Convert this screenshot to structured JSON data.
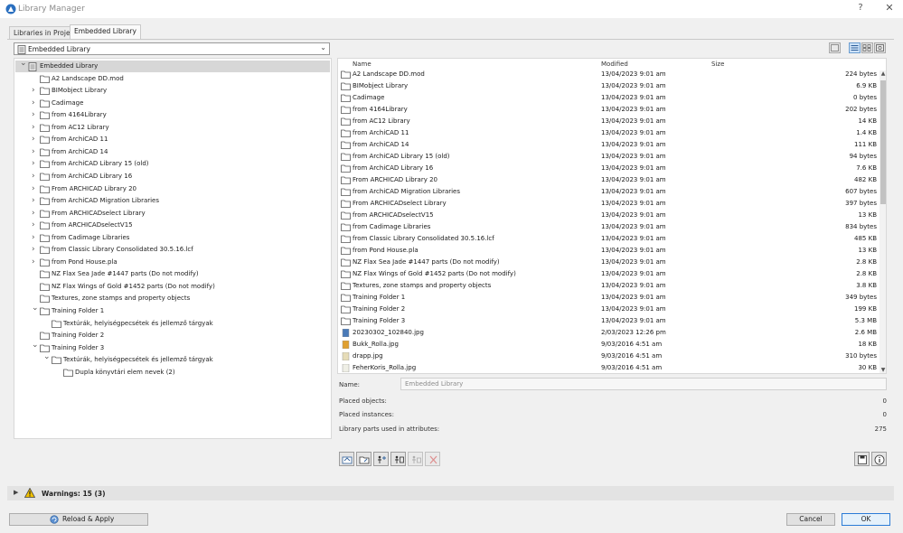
{
  "window": {
    "title": "Library Manager",
    "help": "?",
    "close": "✕"
  },
  "tabs": [
    {
      "label": "Libraries in Project",
      "active": false
    },
    {
      "label": "Embedded Library",
      "active": true
    }
  ],
  "dropdown": {
    "value": "Embedded Library"
  },
  "tree": [
    {
      "label": "Embedded Library",
      "type": "library",
      "indent": 0,
      "expanded": true,
      "selected": true
    },
    {
      "label": "A2 Landscape DD.mod",
      "type": "folder",
      "indent": 1,
      "expandable": false
    },
    {
      "label": "BIMobject Library",
      "type": "folder",
      "indent": 1,
      "expandable": true
    },
    {
      "label": "Cadimage",
      "type": "folder",
      "indent": 1,
      "expandable": true
    },
    {
      "label": "from 4164Library",
      "type": "folder",
      "indent": 1,
      "expandable": true
    },
    {
      "label": "from AC12 Library",
      "type": "folder",
      "indent": 1,
      "expandable": true
    },
    {
      "label": "from ArchiCAD 11",
      "type": "folder",
      "indent": 1,
      "expandable": true
    },
    {
      "label": "from ArchiCAD 14",
      "type": "folder",
      "indent": 1,
      "expandable": true
    },
    {
      "label": "from ArchiCAD Library 15 (old)",
      "type": "folder",
      "indent": 1,
      "expandable": true
    },
    {
      "label": "from ArchiCAD Library 16",
      "type": "folder",
      "indent": 1,
      "expandable": true
    },
    {
      "label": "From ARCHICAD Library 20",
      "type": "folder",
      "indent": 1,
      "expandable": true
    },
    {
      "label": "from ArchiCAD Migration Libraries",
      "type": "folder",
      "indent": 1,
      "expandable": true
    },
    {
      "label": "From ARCHICADselect Library",
      "type": "folder",
      "indent": 1,
      "expandable": true
    },
    {
      "label": "from ARCHICADselectV15",
      "type": "folder",
      "indent": 1,
      "expandable": true
    },
    {
      "label": "from Cadimage Libraries",
      "type": "folder",
      "indent": 1,
      "expandable": true
    },
    {
      "label": "from Classic Library Consolidated 30.5.16.lcf",
      "type": "folder",
      "indent": 1,
      "expandable": true
    },
    {
      "label": "from Pond House.pla",
      "type": "folder",
      "indent": 1,
      "expandable": true
    },
    {
      "label": "NZ Flax Sea Jade #1447 parts (Do not modify)",
      "type": "folder",
      "indent": 1,
      "expandable": false
    },
    {
      "label": "NZ Flax Wings of Gold #1452 parts (Do not modify)",
      "type": "folder",
      "indent": 1,
      "expandable": false
    },
    {
      "label": "Textures, zone stamps and property objects",
      "type": "folder",
      "indent": 1,
      "expandable": false
    },
    {
      "label": "Training Folder 1",
      "type": "folder",
      "indent": 1,
      "expandable": true,
      "expanded": true
    },
    {
      "label": "Textúrák, helyiségpecsétek és jellemző tárgyak",
      "type": "folder",
      "indent": 2,
      "expandable": false
    },
    {
      "label": "Training Folder 2",
      "type": "folder",
      "indent": 1,
      "expandable": false
    },
    {
      "label": "Training Folder 3",
      "type": "folder",
      "indent": 1,
      "expandable": true,
      "expanded": true
    },
    {
      "label": "Textúrák, helyiségpecsétek és jellemző tárgyak",
      "type": "folder",
      "indent": 2,
      "expandable": true,
      "expanded": true
    },
    {
      "label": "Dupla könyvtári elem nevek (2)",
      "type": "folder",
      "indent": 3,
      "expandable": false
    }
  ],
  "list": {
    "columns": {
      "name": "Name",
      "modified": "Modified",
      "size": "Size"
    },
    "rows": [
      {
        "name": "A2 Landscape DD.mod",
        "modified": "13/04/2023 9:01 am",
        "size": "224 bytes",
        "icon": "folder"
      },
      {
        "name": "BIMobject Library",
        "modified": "13/04/2023 9:01 am",
        "size": "6.9 KB",
        "icon": "folder"
      },
      {
        "name": "Cadimage",
        "modified": "13/04/2023 9:01 am",
        "size": "0 bytes",
        "icon": "folder"
      },
      {
        "name": "from 4164Library",
        "modified": "13/04/2023 9:01 am",
        "size": "202 bytes",
        "icon": "folder"
      },
      {
        "name": "from AC12 Library",
        "modified": "13/04/2023 9:01 am",
        "size": "14 KB",
        "icon": "folder"
      },
      {
        "name": "from ArchiCAD 11",
        "modified": "13/04/2023 9:01 am",
        "size": "1.4 KB",
        "icon": "folder"
      },
      {
        "name": "from ArchiCAD 14",
        "modified": "13/04/2023 9:01 am",
        "size": "111 KB",
        "icon": "folder"
      },
      {
        "name": "from ArchiCAD Library 15 (old)",
        "modified": "13/04/2023 9:01 am",
        "size": "94 bytes",
        "icon": "folder"
      },
      {
        "name": "from ArchiCAD Library 16",
        "modified": "13/04/2023 9:01 am",
        "size": "7.6 KB",
        "icon": "folder"
      },
      {
        "name": "From ARCHICAD Library 20",
        "modified": "13/04/2023 9:01 am",
        "size": "482 KB",
        "icon": "folder"
      },
      {
        "name": "from ArchiCAD Migration Libraries",
        "modified": "13/04/2023 9:01 am",
        "size": "607 bytes",
        "icon": "folder"
      },
      {
        "name": "From ARCHICADselect Library",
        "modified": "13/04/2023 9:01 am",
        "size": "397 bytes",
        "icon": "folder"
      },
      {
        "name": "from ARCHICADselectV15",
        "modified": "13/04/2023 9:01 am",
        "size": "13 KB",
        "icon": "folder"
      },
      {
        "name": "from Cadimage Libraries",
        "modified": "13/04/2023 9:01 am",
        "size": "834 bytes",
        "icon": "folder"
      },
      {
        "name": "from Classic Library Consolidated 30.5.16.lcf",
        "modified": "13/04/2023 9:01 am",
        "size": "485 KB",
        "icon": "folder"
      },
      {
        "name": "from Pond House.pla",
        "modified": "13/04/2023 9:01 am",
        "size": "13 KB",
        "icon": "folder"
      },
      {
        "name": "NZ Flax Sea Jade #1447 parts (Do not modify)",
        "modified": "13/04/2023 9:01 am",
        "size": "2.8 KB",
        "icon": "folder"
      },
      {
        "name": "NZ Flax Wings of Gold #1452 parts (Do not modify)",
        "modified": "13/04/2023 9:01 am",
        "size": "2.8 KB",
        "icon": "folder"
      },
      {
        "name": "Textures, zone stamps and property objects",
        "modified": "13/04/2023 9:01 am",
        "size": "3.8 KB",
        "icon": "folder"
      },
      {
        "name": "Training Folder 1",
        "modified": "13/04/2023 9:01 am",
        "size": "349 bytes",
        "icon": "folder"
      },
      {
        "name": "Training Folder 2",
        "modified": "13/04/2023 9:01 am",
        "size": "199 KB",
        "icon": "folder"
      },
      {
        "name": "Training Folder 3",
        "modified": "13/04/2023 9:01 am",
        "size": "5.3 MB",
        "icon": "folder"
      },
      {
        "name": "20230302_102840.jpg",
        "modified": "2/03/2023 12:26 pm",
        "size": "2.6 MB",
        "icon": "photo"
      },
      {
        "name": "Bukk_Rolla.jpg",
        "modified": "9/03/2016 4:51 am",
        "size": "18 KB",
        "icon": "wood"
      },
      {
        "name": "drapp.jpg",
        "modified": "9/03/2016 4:51 am",
        "size": "310 bytes",
        "icon": "beige"
      },
      {
        "name": "FeherKoris_Rolla.jpg",
        "modified": "9/03/2016 4:51 am",
        "size": "30 KB",
        "icon": "pale"
      }
    ]
  },
  "info": {
    "name_label": "Name:",
    "name_value": "Embedded Library",
    "placed_objects_label": "Placed objects:",
    "placed_objects_value": "0",
    "placed_instances_label": "Placed instances:",
    "placed_instances_value": "0",
    "used_in_attributes_label": "Library parts used in attributes:",
    "used_in_attributes_value": "275"
  },
  "toolbar": {
    "buttons": [
      {
        "name": "embed-library-button",
        "icon": "embed-icon",
        "enabled": true
      },
      {
        "name": "open-folder-button",
        "icon": "open-folder-icon",
        "enabled": true
      },
      {
        "name": "add-parts-button",
        "icon": "add-parts-icon",
        "enabled": true
      },
      {
        "name": "move-parts-button",
        "icon": "move-parts-icon",
        "enabled": true
      },
      {
        "name": "duplicate-parts-button",
        "icon": "duplicate-icon",
        "enabled": false
      },
      {
        "name": "delete-button",
        "icon": "delete-icon",
        "enabled": false
      }
    ]
  },
  "warnings": {
    "label": "Warnings: 15 (3)"
  },
  "buttons": {
    "reload": "Reload & Apply",
    "cancel": "Cancel",
    "ok": "OK"
  },
  "colors": {
    "accent": "#2b7bd6",
    "selection": "#d7d7d7",
    "warning": "#f2c200"
  }
}
